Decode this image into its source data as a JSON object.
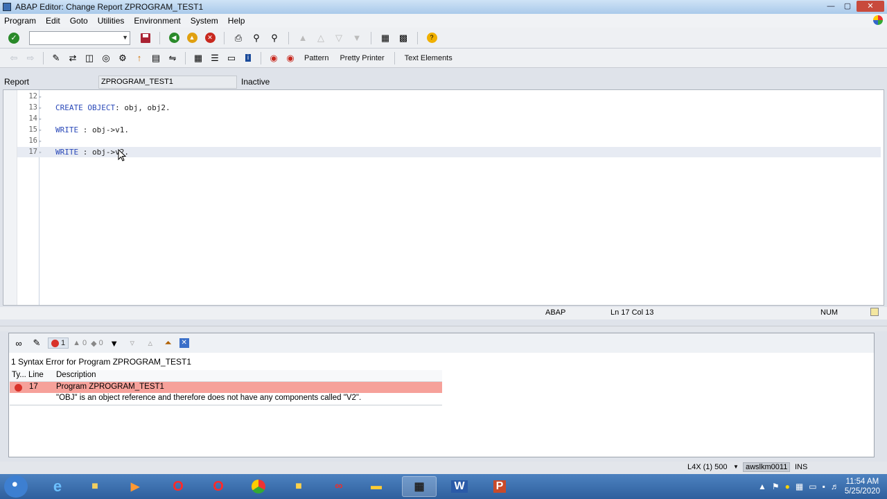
{
  "window": {
    "title": "ABAP Editor: Change Report ZPROGRAM_TEST1"
  },
  "menu": [
    "Program",
    "Edit",
    "Goto",
    "Utilities",
    "Environment",
    "System",
    "Help"
  ],
  "toolbar": {
    "pattern_label": "Pattern",
    "pretty_printer_label": "Pretty Printer",
    "text_elements_label": "Text Elements"
  },
  "report": {
    "label": "Report",
    "name": "ZPROGRAM_TEST1",
    "state": "Inactive"
  },
  "editor": {
    "lines": [
      {
        "n": "12",
        "kw": "",
        "rest": ""
      },
      {
        "n": "13",
        "kw": "CREATE OBJECT",
        "rest": ": obj, obj2."
      },
      {
        "n": "14",
        "kw": "",
        "rest": ""
      },
      {
        "n": "15",
        "kw": "WRITE",
        "rest": " : obj->v1."
      },
      {
        "n": "16",
        "kw": "",
        "rest": ""
      },
      {
        "n": "17",
        "kw": "WRITE",
        "rest": " : obj->v2."
      }
    ],
    "current_line": "17"
  },
  "status": {
    "language": "ABAP",
    "position": "Ln 17 Col 13",
    "num": "NUM"
  },
  "errors": {
    "error_count": "1",
    "warning_count": "0",
    "info_count": "0",
    "summary": "1 Syntax Error for Program ZPROGRAM_TEST1",
    "columns": {
      "type": "Ty...",
      "line": "Line",
      "description": "Description"
    },
    "rows": [
      {
        "line": "17",
        "program": "Program ZPROGRAM_TEST1",
        "message": "\"OBJ\" is an object reference and therefore does not have any components called \"V2\"."
      }
    ]
  },
  "sap_status": {
    "system": "L4X (1) 500",
    "user": "awslkm0011",
    "mode": "INS"
  },
  "taskbar": {
    "time": "11:54 AM",
    "date": "5/25/2020"
  },
  "colors": {
    "error_row": "#f6a19a",
    "keyword": "#2948b8",
    "taskbar": "#2e5f9d"
  }
}
